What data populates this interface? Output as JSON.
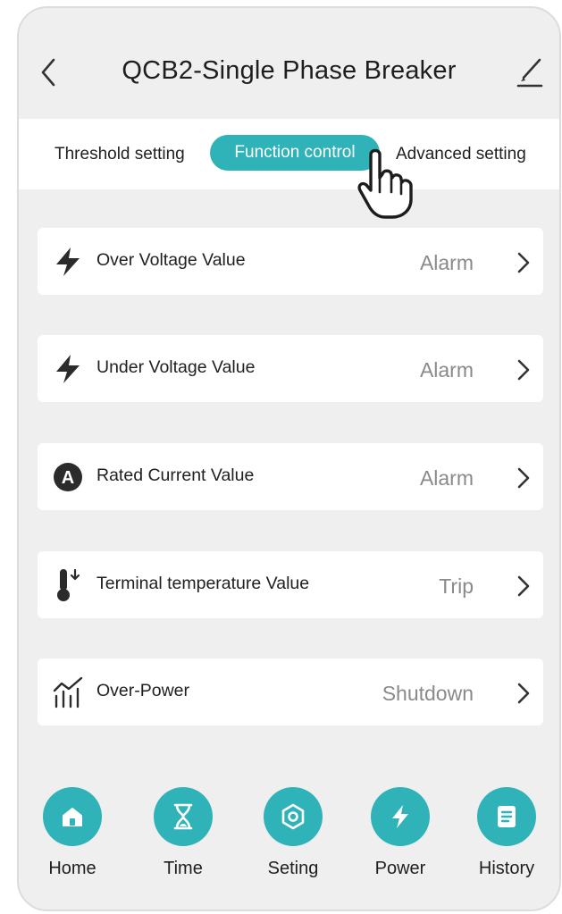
{
  "header": {
    "title": "QCB2-Single Phase Breaker"
  },
  "tabs": [
    {
      "label": "Threshold setting",
      "active": false
    },
    {
      "label": "Function control",
      "active": true
    },
    {
      "label": "Advanced setting",
      "active": false
    }
  ],
  "rows": [
    {
      "icon": "lightning-icon",
      "label": "Over Voltage Value",
      "value": "Alarm"
    },
    {
      "icon": "lightning-icon",
      "label": "Under Voltage Value",
      "value": "Alarm"
    },
    {
      "icon": "ampere-icon",
      "icon_text": "A",
      "label": "Rated Current Value",
      "value": "Alarm"
    },
    {
      "icon": "thermometer-icon",
      "label": "Terminal temperature Value",
      "value": "Trip"
    },
    {
      "icon": "power-chart-icon",
      "label": "Over-Power",
      "value": "Shutdown"
    }
  ],
  "nav": [
    {
      "icon": "home-icon",
      "label": "Home"
    },
    {
      "icon": "hourglass-icon",
      "label": "Time"
    },
    {
      "icon": "hexagon-settings-icon",
      "label": "Seting"
    },
    {
      "icon": "lightning-icon",
      "label": "Power"
    },
    {
      "icon": "document-icon",
      "label": "History"
    }
  ],
  "colors": {
    "accent": "#2fb3b8",
    "background": "#efefef",
    "value_text": "#8a8a8a",
    "icon_dark": "#2b2b2b"
  }
}
